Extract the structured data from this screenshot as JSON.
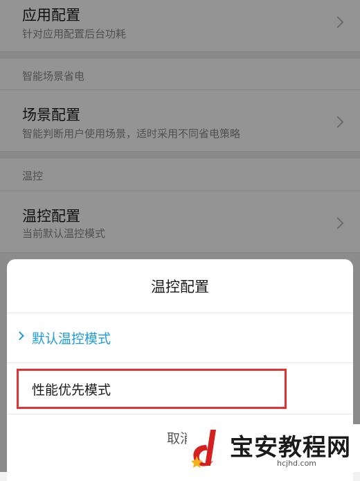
{
  "settings": {
    "app_config": {
      "title": "应用配置",
      "subtitle": "针对应用配置后台功耗"
    },
    "smart_section": {
      "header": "智能场景省电"
    },
    "scene_config": {
      "title": "场景配置",
      "subtitle": "智能判断用户使用场景，适时采用不同省电策略"
    },
    "temp_section": {
      "header": "温控"
    },
    "temp_config": {
      "title": "温控配置",
      "subtitle": "当前默认温控模式"
    }
  },
  "dialog": {
    "title": "温控配置",
    "options": [
      {
        "label": "默认温控模式",
        "selected": true
      },
      {
        "label": "性能优先模式",
        "selected": false
      }
    ],
    "cancel_label": "取消"
  },
  "watermark": {
    "text": "宝安教程网",
    "url": "hcjhd.com"
  },
  "colors": {
    "accent": "#1e9bdc",
    "highlight": "#e03232",
    "overlay": "rgba(0,0,0,0.42)"
  }
}
